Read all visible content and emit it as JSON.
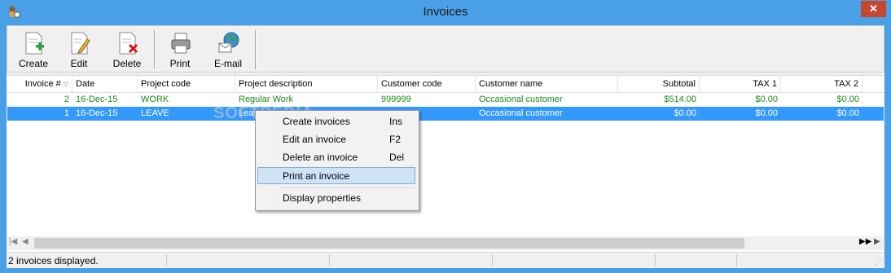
{
  "window": {
    "title": "Invoices",
    "close_label": "✕"
  },
  "toolbar": {
    "buttons": [
      {
        "label": "Create",
        "icon": "create-document-icon"
      },
      {
        "label": "Edit",
        "icon": "edit-document-icon"
      },
      {
        "label": "Delete",
        "icon": "delete-document-icon"
      },
      {
        "label": "Print",
        "icon": "printer-icon"
      },
      {
        "label": "E-mail",
        "icon": "email-globe-icon"
      }
    ]
  },
  "table": {
    "columns": [
      "Invoice #",
      "Date",
      "Project code",
      "Project description",
      "Customer code",
      "Customer name",
      "Subtotal",
      "TAX 1",
      "TAX 2"
    ],
    "rows": [
      {
        "invoice": "2",
        "date": "16-Dec-15",
        "project_code": "WORK",
        "project_description": "Regular Work",
        "customer_code": "999999",
        "customer_name": "Occasional customer",
        "subtotal": "$514.00",
        "tax1": "$0.00",
        "tax2": "$0.00",
        "selected": false
      },
      {
        "invoice": "1",
        "date": "16-Dec-15",
        "project_code": "LEAVE",
        "project_description": "Leav",
        "customer_code": "",
        "customer_name": "Occasional customer",
        "subtotal": "$0.00",
        "tax1": "$0.00",
        "tax2": "$0.00",
        "selected": true
      }
    ]
  },
  "context_menu": {
    "items": [
      {
        "label": "Create invoices",
        "shortcut": "Ins"
      },
      {
        "label": "Edit an invoice",
        "shortcut": "F2"
      },
      {
        "label": "Delete an invoice",
        "shortcut": "Del"
      },
      {
        "label": "Print an invoice",
        "shortcut": ""
      },
      {
        "label": "Display properties",
        "shortcut": ""
      }
    ]
  },
  "status": {
    "text": "2 invoices displayed."
  },
  "watermark": "SOFTPEDIA",
  "colors": {
    "accent": "#3399ff",
    "green_text": "#1b8a1b",
    "titlebar": "#4aa0e6",
    "close": "#c7462e"
  }
}
